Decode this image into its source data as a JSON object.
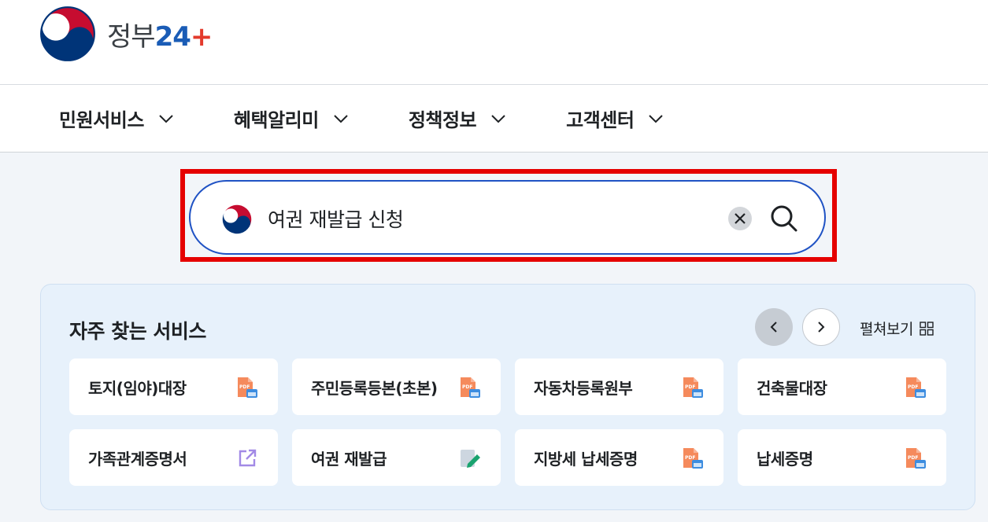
{
  "logo": {
    "name": "정부",
    "number": "24",
    "plus": "+"
  },
  "nav": [
    {
      "label": "민원서비스"
    },
    {
      "label": "혜택알리미"
    },
    {
      "label": "정책정보"
    },
    {
      "label": "고객센터"
    }
  ],
  "search": {
    "value": "여권 재발급 신청"
  },
  "frequent": {
    "title": "자주 찾는 서비스",
    "view_all": "펼쳐보기",
    "items": [
      {
        "label": "토지(임야)대장",
        "icon": "pdf-icon"
      },
      {
        "label": "주민등록등본(초본)",
        "icon": "pdf-icon"
      },
      {
        "label": "자동차등록원부",
        "icon": "pdf-icon"
      },
      {
        "label": "건축물대장",
        "icon": "pdf-icon"
      },
      {
        "label": "가족관계증명서",
        "icon": "external-link-icon"
      },
      {
        "label": "여권 재발급",
        "icon": "edit-doc-icon"
      },
      {
        "label": "지방세 납세증명",
        "icon": "pdf-icon"
      },
      {
        "label": "납세증명",
        "icon": "pdf-icon"
      }
    ]
  },
  "colors": {
    "accent": "#1f52c4",
    "highlight": "#e50000",
    "panel": "#e7f1fb"
  }
}
